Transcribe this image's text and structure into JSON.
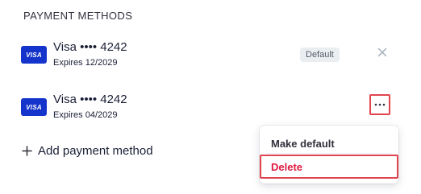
{
  "section": {
    "title": "PAYMENT METHODS"
  },
  "payment_methods": [
    {
      "brand_logo": "VISA",
      "label": "Visa •••• 4242",
      "expires": "Expires 12/2029",
      "badge": "Default",
      "action_icon": "close-icon"
    },
    {
      "brand_logo": "VISA",
      "label": "Visa •••• 4242",
      "expires": "Expires 04/2029",
      "action_icon": "more-horizontal-icon"
    }
  ],
  "add_method": {
    "icon": "plus-icon",
    "label": "Add payment method"
  },
  "context_menu": {
    "items": [
      {
        "label": "Make default"
      },
      {
        "label": "Delete"
      }
    ]
  },
  "colors": {
    "visa_blue": "#1434cb",
    "delete_red": "#df1b41",
    "highlight_border": "#e0454f"
  }
}
